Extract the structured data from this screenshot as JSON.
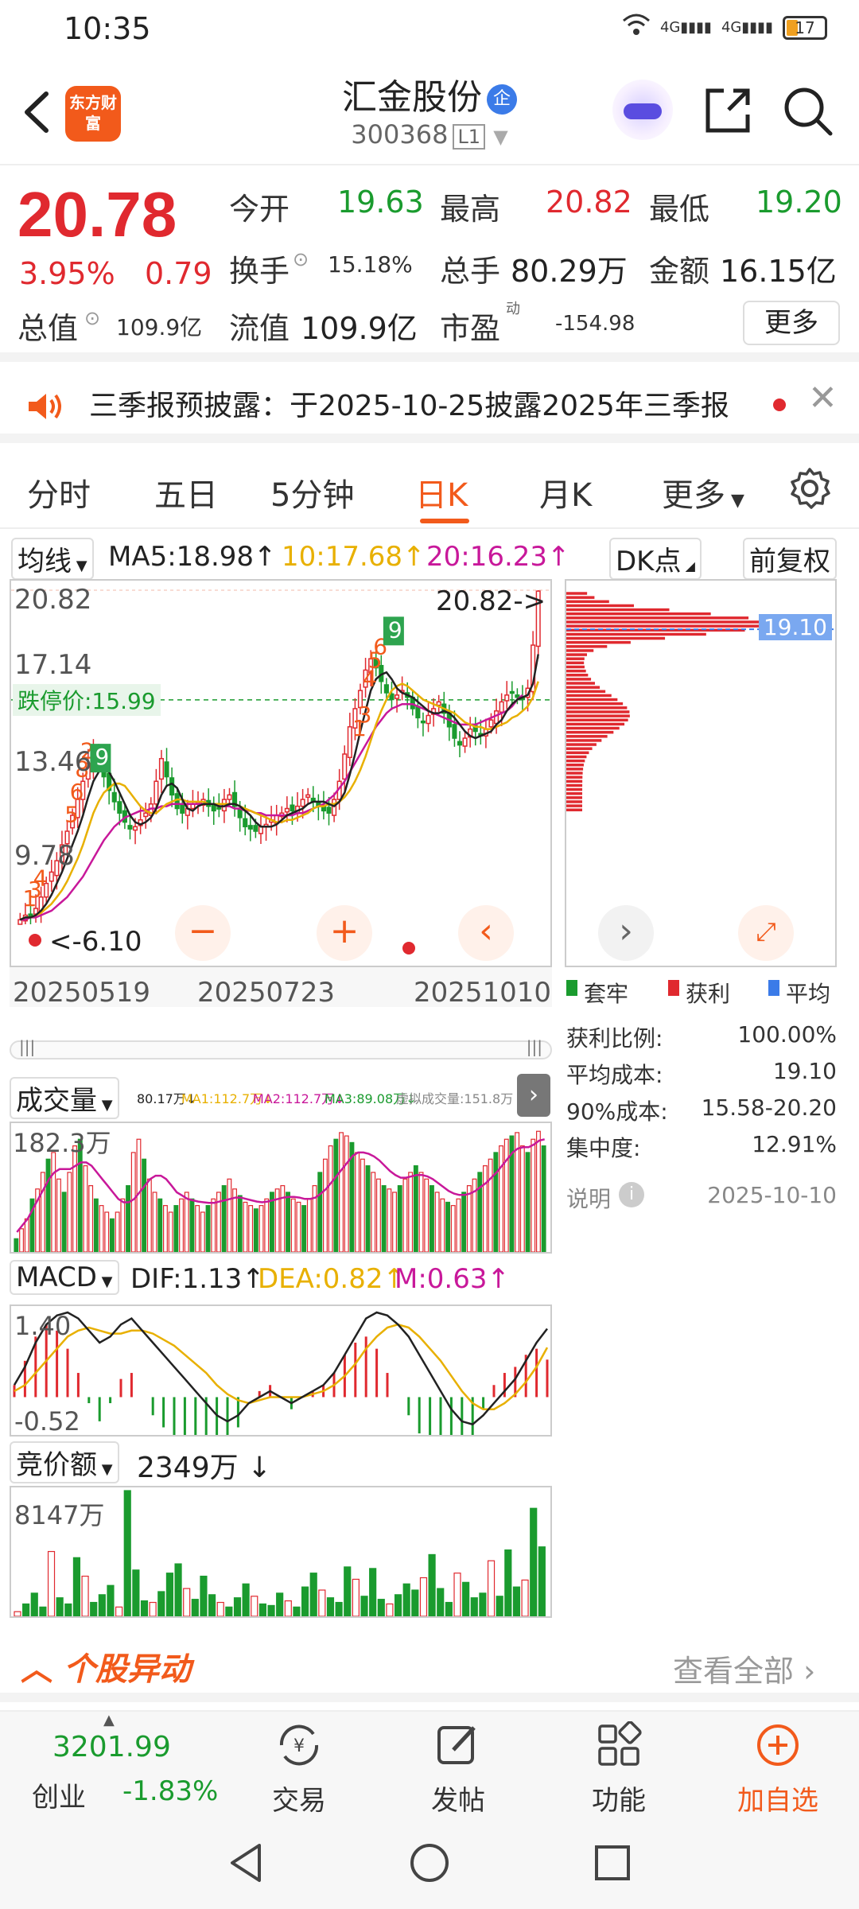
{
  "status_bar": {
    "time": "10:35",
    "signal": "4G",
    "battery": "17"
  },
  "header": {
    "logo_text": "东方财富",
    "stock_name": "汇金股份",
    "badge": "企",
    "stock_code": "300368",
    "level": "L1"
  },
  "quote": {
    "price": "20.78",
    "change_pct": "3.95%",
    "change": "0.79",
    "open_label": "今开",
    "open": "19.63",
    "high_label": "最高",
    "high": "20.82",
    "low_label": "最低",
    "low": "19.20",
    "turnover_label": "换手",
    "turnover": "15.18%",
    "volume_label": "总手",
    "volume": "80.29万",
    "amount_label": "金额",
    "amount": "16.15亿",
    "mktcap_label": "总值",
    "mktcap": "109.9亿",
    "float_label": "流值",
    "float_cap": "109.9亿",
    "pe_label": "市盈",
    "pe_sup": "动",
    "pe": "-154.98",
    "more_label": "更多"
  },
  "notice": {
    "text": "三季报预披露：于2025-10-25披露2025年三季报"
  },
  "tabs": [
    "分时",
    "五日",
    "5分钟",
    "日K",
    "月K",
    "更多"
  ],
  "active_tab": "日K",
  "ma_row": {
    "selector": "均线",
    "ma5": "MA5:18.98",
    "ma10": "10:17.68",
    "ma20": "20:16.23",
    "dk_button": "DK点",
    "adjust_button": "前复权"
  },
  "kline": {
    "y_labels": [
      "20.82",
      "17.14",
      "13.46",
      "9.78",
      "6.10"
    ],
    "limit_down_label": "跌停价:15.99",
    "max_annotation": "20.82->",
    "min_annotation": "<-6.10",
    "dates": [
      "20250519",
      "20250723",
      "20251010"
    ],
    "markers_red": [
      "1",
      "3",
      "4",
      "5",
      "6",
      "8",
      "2",
      "1",
      "3",
      "4",
      "5",
      "6"
    ],
    "markers_green": [
      "9",
      "9"
    ]
  },
  "chip": {
    "avg_cost_tag": "19.10",
    "legend": [
      "套牢",
      "获利",
      "平均"
    ],
    "stats": [
      {
        "label": "获利比例:",
        "value": "100.00%"
      },
      {
        "label": "平均成本:",
        "value": "19.10"
      },
      {
        "label": "90%成本:",
        "value": "15.58-20.20"
      },
      {
        "label": "集中度:",
        "value": "12.91%"
      }
    ],
    "note_label": "说明",
    "note_date": "2025-10-10"
  },
  "volume_panel": {
    "selector": "成交量",
    "vol": "80.17万",
    "ma1": "MA1:112.7万",
    "ma2": "MA2:112.7万",
    "ma3": "MA3:89.08万",
    "virtual": "虚拟成交量:151.8万",
    "y_max": "182.3万"
  },
  "macd_panel": {
    "selector": "MACD",
    "dif": "DIF:1.13",
    "dea": "DEA:0.82",
    "m": "M:0.63",
    "y_max": "1.40",
    "y_min": "-0.52"
  },
  "auction_panel": {
    "selector": "竞价额",
    "value": "2349万",
    "y_max": "8147万"
  },
  "movement": {
    "title": "个股异动",
    "view_all": "查看全部"
  },
  "bottom_nav": {
    "index_value": "3201.99",
    "index_name": "创业",
    "index_pct": "-1.83%",
    "items": [
      "交易",
      "发帖",
      "功能",
      "加自选"
    ]
  },
  "colors": {
    "up": "#e0292f",
    "down": "#1a9b2e",
    "accent": "#f25a1b",
    "ma5": "#222222",
    "ma10": "#e8b000",
    "ma20": "#c8189a"
  },
  "icons": [
    "back-icon",
    "share-icon",
    "search-icon",
    "settings-icon",
    "volume-speaker-icon",
    "close-icon"
  ],
  "chart_data": [
    {
      "type": "candlestick",
      "title": "日K",
      "x_ticks": [
        "20250519",
        "20250723",
        "20251010"
      ],
      "ylim": [
        6.1,
        20.82
      ],
      "y_ticks": [
        20.82,
        17.14,
        13.46,
        9.78,
        6.1
      ],
      "close": [
        6.3,
        6.5,
        6.4,
        6.8,
        7.3,
        7.9,
        8.4,
        8.9,
        9.6,
        10.2,
        10.9,
        11.6,
        12.4,
        13.2,
        13.8,
        13.3,
        12.6,
        12.0,
        11.5,
        11.0,
        10.6,
        10.3,
        10.4,
        10.7,
        11.0,
        11.4,
        12.4,
        13.4,
        12.6,
        11.8,
        11.2,
        11.0,
        11.2,
        11.4,
        11.5,
        11.6,
        11.3,
        11.1,
        11.2,
        11.6,
        11.8,
        11.3,
        10.8,
        10.4,
        10.3,
        10.2,
        10.4,
        10.5,
        10.7,
        10.9,
        11.0,
        11.2,
        11.1,
        11.3,
        11.6,
        11.8,
        11.5,
        11.3,
        11.1,
        11.0,
        11.6,
        12.4,
        13.6,
        14.8,
        15.6,
        16.4,
        17.3,
        17.8,
        17.4,
        16.8,
        16.3,
        16.0,
        16.2,
        16.4,
        16.1,
        15.6,
        15.2,
        15.0,
        15.3,
        15.6,
        15.9,
        15.4,
        14.8,
        14.3,
        14.0,
        14.3,
        14.7,
        14.6,
        14.4,
        14.7,
        15.1,
        15.5,
        15.9,
        16.2,
        16.3,
        16.1,
        16.0,
        16.5,
        18.4,
        20.78
      ],
      "ma5": [
        6.3,
        6.4,
        6.4,
        6.5,
        6.7,
        7.0,
        7.4,
        7.9,
        8.4,
        9.0,
        9.6,
        10.2,
        10.9,
        11.7,
        12.4,
        12.8,
        13.1,
        12.8,
        12.4,
        11.9,
        11.4,
        10.9,
        10.6,
        10.5,
        10.6,
        10.8,
        11.2,
        11.8,
        12.2,
        12.3,
        12.1,
        11.6,
        11.2,
        11.1,
        11.3,
        11.4,
        11.4,
        11.4,
        11.3,
        11.3,
        11.4,
        11.4,
        11.3,
        11.1,
        10.9,
        10.6,
        10.4,
        10.4,
        10.4,
        10.5,
        10.7,
        10.9,
        11.0,
        11.1,
        11.2,
        11.4,
        11.5,
        11.5,
        11.5,
        11.4,
        11.3,
        11.5,
        11.9,
        12.7,
        13.6,
        14.6,
        15.5,
        16.4,
        16.9,
        17.1,
        17.2,
        16.9,
        16.5,
        16.3,
        16.2,
        16.1,
        15.9,
        15.7,
        15.5,
        15.4,
        15.4,
        15.5,
        15.4,
        15.2,
        14.9,
        14.6,
        14.4,
        14.3,
        14.4,
        14.5,
        14.6,
        14.9,
        15.1,
        15.5,
        15.8,
        16.0,
        16.1,
        16.2,
        16.7,
        18.0
      ],
      "ma10": [
        6.3,
        6.4,
        6.4,
        6.5,
        6.6,
        6.8,
        7.0,
        7.3,
        7.6,
        8.0,
        8.5,
        9.0,
        9.6,
        10.3,
        11.0,
        11.5,
        11.9,
        12.1,
        12.3,
        12.3,
        12.2,
        11.9,
        11.6,
        11.3,
        11.1,
        11.0,
        11.0,
        11.2,
        11.4,
        11.5,
        11.6,
        11.6,
        11.5,
        11.5,
        11.5,
        11.5,
        11.4,
        11.4,
        11.4,
        11.4,
        11.4,
        11.4,
        11.3,
        11.2,
        11.1,
        11.0,
        10.9,
        10.8,
        10.7,
        10.6,
        10.6,
        10.7,
        10.7,
        10.8,
        10.9,
        11.0,
        11.2,
        11.3,
        11.3,
        11.4,
        11.4,
        11.5,
        11.7,
        12.0,
        12.4,
        12.9,
        13.5,
        14.2,
        14.9,
        15.5,
        16.0,
        16.4,
        16.6,
        16.7,
        16.6,
        16.4,
        16.2,
        16.0,
        15.9,
        15.8,
        15.7,
        15.6,
        15.5,
        15.4,
        15.2,
        15.0,
        14.9,
        14.8,
        14.8,
        14.7,
        14.7,
        14.8,
        14.9,
        15.0,
        15.2,
        15.3,
        15.5,
        15.7,
        16.1,
        16.8
      ],
      "ma20": [
        6.3,
        6.3,
        6.4,
        6.4,
        6.5,
        6.6,
        6.7,
        6.9,
        7.1,
        7.3,
        7.6,
        7.9,
        8.2,
        8.6,
        9.0,
        9.4,
        9.8,
        10.1,
        10.4,
        10.6,
        10.8,
        10.9,
        11.0,
        11.1,
        11.1,
        11.2,
        11.2,
        11.3,
        11.3,
        11.4,
        11.4,
        11.4,
        11.4,
        11.4,
        11.4,
        11.4,
        11.4,
        11.4,
        11.3,
        11.3,
        11.3,
        11.2,
        11.2,
        11.1,
        11.1,
        11.0,
        11.0,
        10.9,
        10.9,
        10.9,
        10.9,
        10.9,
        10.9,
        11.0,
        11.0,
        11.1,
        11.2,
        11.3,
        11.4,
        11.6,
        11.8,
        12.1,
        12.4,
        12.8,
        13.2,
        13.6,
        14.0,
        14.4,
        14.8,
        15.1,
        15.4,
        15.6,
        15.7,
        15.8,
        15.8,
        15.8,
        15.7,
        15.6,
        15.5,
        15.4,
        15.3,
        15.2,
        15.1,
        15.0,
        14.9,
        14.9,
        14.9,
        14.9,
        15.0,
        15.1,
        15.2,
        15.3,
        15.4,
        15.5,
        15.7,
        16.0,
        16.2
      ]
    },
    {
      "type": "bar",
      "title": "成交量",
      "ylim": [
        0,
        182.3
      ],
      "values": [
        20,
        35,
        50,
        80,
        95,
        120,
        140,
        150,
        110,
        90,
        120,
        160,
        170,
        130,
        100,
        80,
        70,
        60,
        50,
        60,
        80,
        100,
        150,
        170,
        140,
        110,
        90,
        80,
        70,
        60,
        70,
        80,
        90,
        80,
        70,
        60,
        70,
        80,
        90,
        100,
        110,
        95,
        85,
        75,
        70,
        65,
        70,
        80,
        90,
        95,
        100,
        90,
        80,
        75,
        70,
        80,
        100,
        120,
        140,
        160,
        170,
        180,
        175,
        165,
        150,
        140,
        130,
        120,
        110,
        100,
        95,
        90,
        100,
        110,
        120,
        130,
        120,
        110,
        100,
        90,
        80,
        75,
        70,
        80,
        90,
        100,
        110,
        120,
        130,
        140,
        150,
        160,
        170,
        175,
        180,
        160,
        150,
        170,
        182,
        160
      ],
      "ma_line": [
        30,
        40,
        50,
        65,
        80,
        95,
        110,
        120,
        125,
        125,
        125,
        130,
        135,
        135,
        130,
        120,
        110,
        100,
        90,
        80,
        75,
        75,
        80,
        90,
        100,
        110,
        115,
        115,
        110,
        100,
        90,
        85,
        80,
        78,
        76,
        75,
        74,
        74,
        76,
        78,
        80,
        82,
        82,
        80,
        78,
        76,
        75,
        76,
        78,
        80,
        82,
        83,
        83,
        82,
        80,
        80,
        82,
        88,
        95,
        105,
        115,
        125,
        135,
        145,
        150,
        150,
        148,
        144,
        138,
        130,
        122,
        116,
        112,
        112,
        114,
        116,
        116,
        114,
        110,
        104,
        98,
        92,
        88,
        86,
        86,
        88,
        92,
        98,
        104,
        112,
        120,
        130,
        140,
        150,
        156,
        158,
        158,
        162,
        168,
        170
      ]
    },
    {
      "type": "line",
      "title": "MACD",
      "ylim": [
        -0.52,
        1.4
      ],
      "dif": [
        0.2,
        0.5,
        0.9,
        1.2,
        1.35,
        1.4,
        1.3,
        1.1,
        0.9,
        1.0,
        1.2,
        1.3,
        1.1,
        0.9,
        0.7,
        0.5,
        0.3,
        0.1,
        -0.1,
        -0.3,
        -0.4,
        -0.3,
        -0.1,
        0.0,
        0.1,
        0.0,
        -0.1,
        0.0,
        0.1,
        0.2,
        0.4,
        0.7,
        1.0,
        1.3,
        1.4,
        1.35,
        1.2,
        1.0,
        0.7,
        0.4,
        0.1,
        -0.2,
        -0.4,
        -0.45,
        -0.3,
        -0.1,
        0.1,
        0.3,
        0.6,
        0.9,
        1.13
      ],
      "dea": [
        0.1,
        0.2,
        0.4,
        0.6,
        0.8,
        1.0,
        1.1,
        1.15,
        1.1,
        1.05,
        1.05,
        1.1,
        1.1,
        1.05,
        0.95,
        0.85,
        0.7,
        0.55,
        0.4,
        0.2,
        0.05,
        -0.05,
        -0.1,
        -0.05,
        0.0,
        0.0,
        0.0,
        0.0,
        0.05,
        0.1,
        0.2,
        0.35,
        0.55,
        0.8,
        1.0,
        1.15,
        1.2,
        1.15,
        1.0,
        0.8,
        0.6,
        0.35,
        0.1,
        -0.1,
        -0.2,
        -0.2,
        -0.1,
        0.05,
        0.25,
        0.5,
        0.82
      ]
    },
    {
      "type": "bar",
      "title": "竞价额",
      "ylim": [
        0,
        8147
      ],
      "values": [
        300,
        800,
        1500,
        600,
        4200,
        1200,
        800,
        3800,
        2600,
        900,
        1400,
        2000,
        600,
        8147,
        3000,
        1000,
        900,
        1600,
        2800,
        3400,
        1800,
        1100,
        2600,
        1400,
        900,
        600,
        1200,
        2100,
        1300,
        800,
        700,
        1500,
        1000,
        600,
        1900,
        2800,
        1700,
        1200,
        900,
        3200,
        2400,
        1300,
        3100,
        1100,
        800,
        1400,
        2100,
        1700,
        2500,
        4000,
        1800,
        900,
        2800,
        2200,
        1200,
        1500,
        3600,
        1300,
        4300,
        1900,
        2349,
        7000,
        4500
      ]
    }
  ]
}
